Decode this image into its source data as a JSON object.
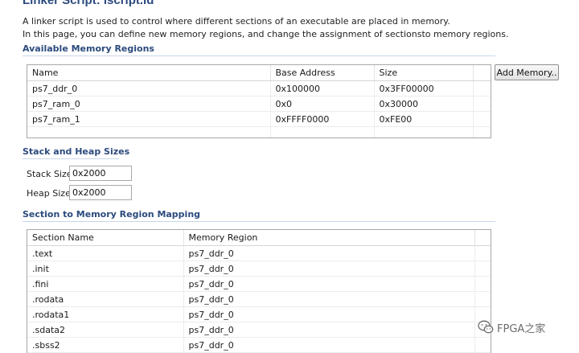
{
  "page": {
    "title": "Linker Script: lscript.ld",
    "description": [
      "A linker script is used to control where different sections of an executable are placed in memory.",
      "In this page, you can define new memory regions, and change the assignment of sectionsto memory regions."
    ]
  },
  "memory_regions": {
    "title": "Available Memory Regions",
    "columns": [
      "Name",
      "Base Address",
      "Size"
    ],
    "rows": [
      [
        "ps7_ddr_0",
        "0x100000",
        "0x3FF00000"
      ],
      [
        "ps7_ram_0",
        "0x0",
        "0x30000"
      ],
      [
        "ps7_ram_1",
        "0xFFFF0000",
        "0xFE00"
      ]
    ],
    "add_button_label": "Add Memory.."
  },
  "stack_heap": {
    "title": "Stack and Heap Sizes",
    "stack_label": "Stack Size",
    "stack_value": "0x2000",
    "heap_label": "Heap Size",
    "heap_value": "0x2000"
  },
  "section_mapping": {
    "title": "Section to Memory Region Mapping",
    "columns": [
      "Section Name",
      "Memory Region"
    ],
    "rows": [
      [
        ".text",
        "ps7_ddr_0"
      ],
      [
        ".init",
        "ps7_ddr_0"
      ],
      [
        ".fini",
        "ps7_ddr_0"
      ],
      [
        ".rodata",
        "ps7_ddr_0"
      ],
      [
        ".rodata1",
        "ps7_ddr_0"
      ],
      [
        ".sdata2",
        "ps7_ddr_0"
      ],
      [
        ".sbss2",
        "ps7_ddr_0"
      ]
    ]
  },
  "watermark": {
    "text": "FPGA之家",
    "icon": "wechat-icon"
  },
  "colors": {
    "section_title": "#2b4a7d",
    "border": "#a8a8a8"
  }
}
